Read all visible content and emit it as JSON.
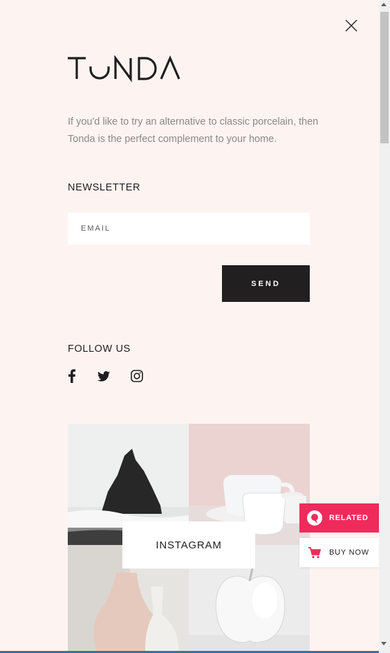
{
  "brand": {
    "logo_text": "TONDA"
  },
  "intro": {
    "text": "If you'd like to try an alternative to classic porcelain, then Tonda is the perfect complement to your home."
  },
  "newsletter": {
    "title": "NEWSLETTER",
    "email_placeholder": "EMAIL",
    "send_label": "SEND"
  },
  "follow": {
    "title": "FOLLOW US",
    "icons": [
      "facebook-icon",
      "twitter-icon",
      "instagram-icon"
    ]
  },
  "instagram": {
    "label": "INSTAGRAM",
    "tiles": [
      "rock-sea-photo",
      "teacups-photo",
      "vases-photo",
      "apple-photo"
    ]
  },
  "floating": {
    "related_label": "RELATED",
    "buynow_label": "BUY NOW"
  },
  "colors": {
    "background": "#fdf4f1",
    "accent": "#ef2b5c",
    "dark": "#221f20",
    "text_muted": "#8c8887"
  }
}
